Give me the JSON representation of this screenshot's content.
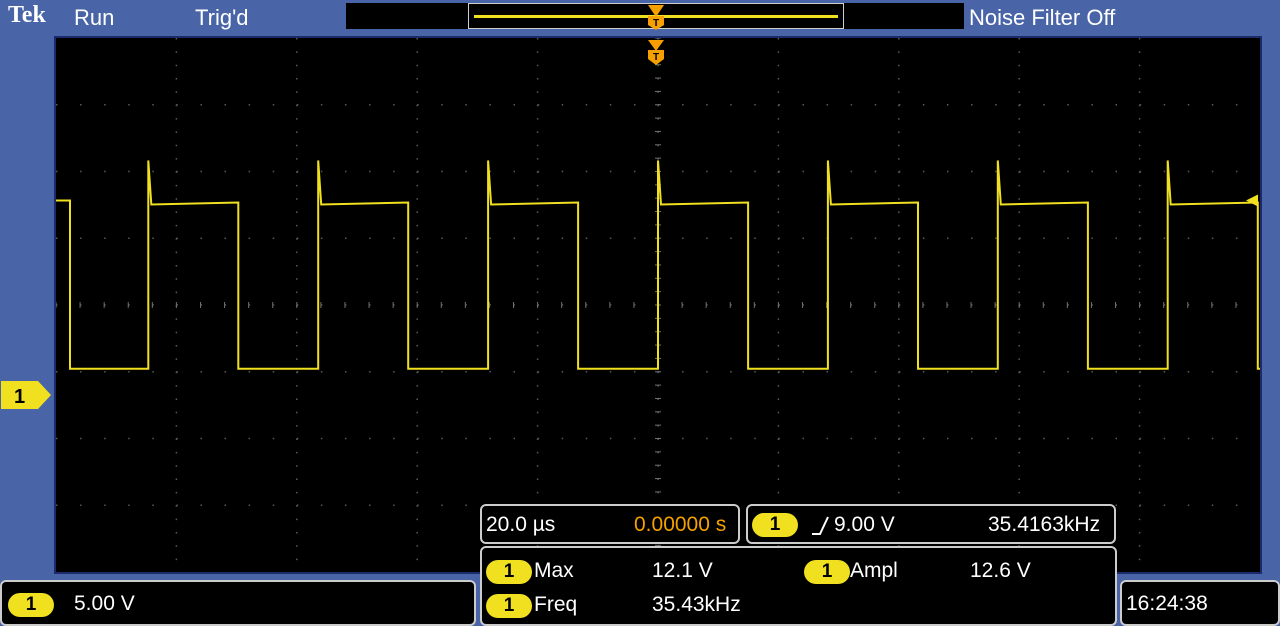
{
  "header": {
    "brand": "Tek",
    "acq_state": "Run",
    "trigger_state": "Trig'd",
    "noise_filter": "Noise Filter Off"
  },
  "channel": {
    "number": "1",
    "scale": "5.00 V",
    "color": "#f0e020"
  },
  "horizontal": {
    "timebase": "20.0 µs",
    "delay": "0.00000 s"
  },
  "trigger": {
    "source": "1",
    "slope_icon": "rising-edge-icon",
    "level": "9.00 V",
    "frequency": "35.4163kHz",
    "marker_color": "#f5a000"
  },
  "measurements": [
    {
      "source": "1",
      "name": "Max",
      "value": "12.1 V"
    },
    {
      "source": "1",
      "name": "Ampl",
      "value": "12.6 V"
    },
    {
      "source": "1",
      "name": "Freq",
      "value": "35.43kHz"
    }
  ],
  "clock": "16:24:38",
  "waveform": {
    "type": "square",
    "frequency_khz": 35.43,
    "high_v": 12.1,
    "amplitude_v": 12.6,
    "duty_low_fraction": 0.47,
    "time_per_div_us": 20.0,
    "volts_per_div": 5.0
  }
}
